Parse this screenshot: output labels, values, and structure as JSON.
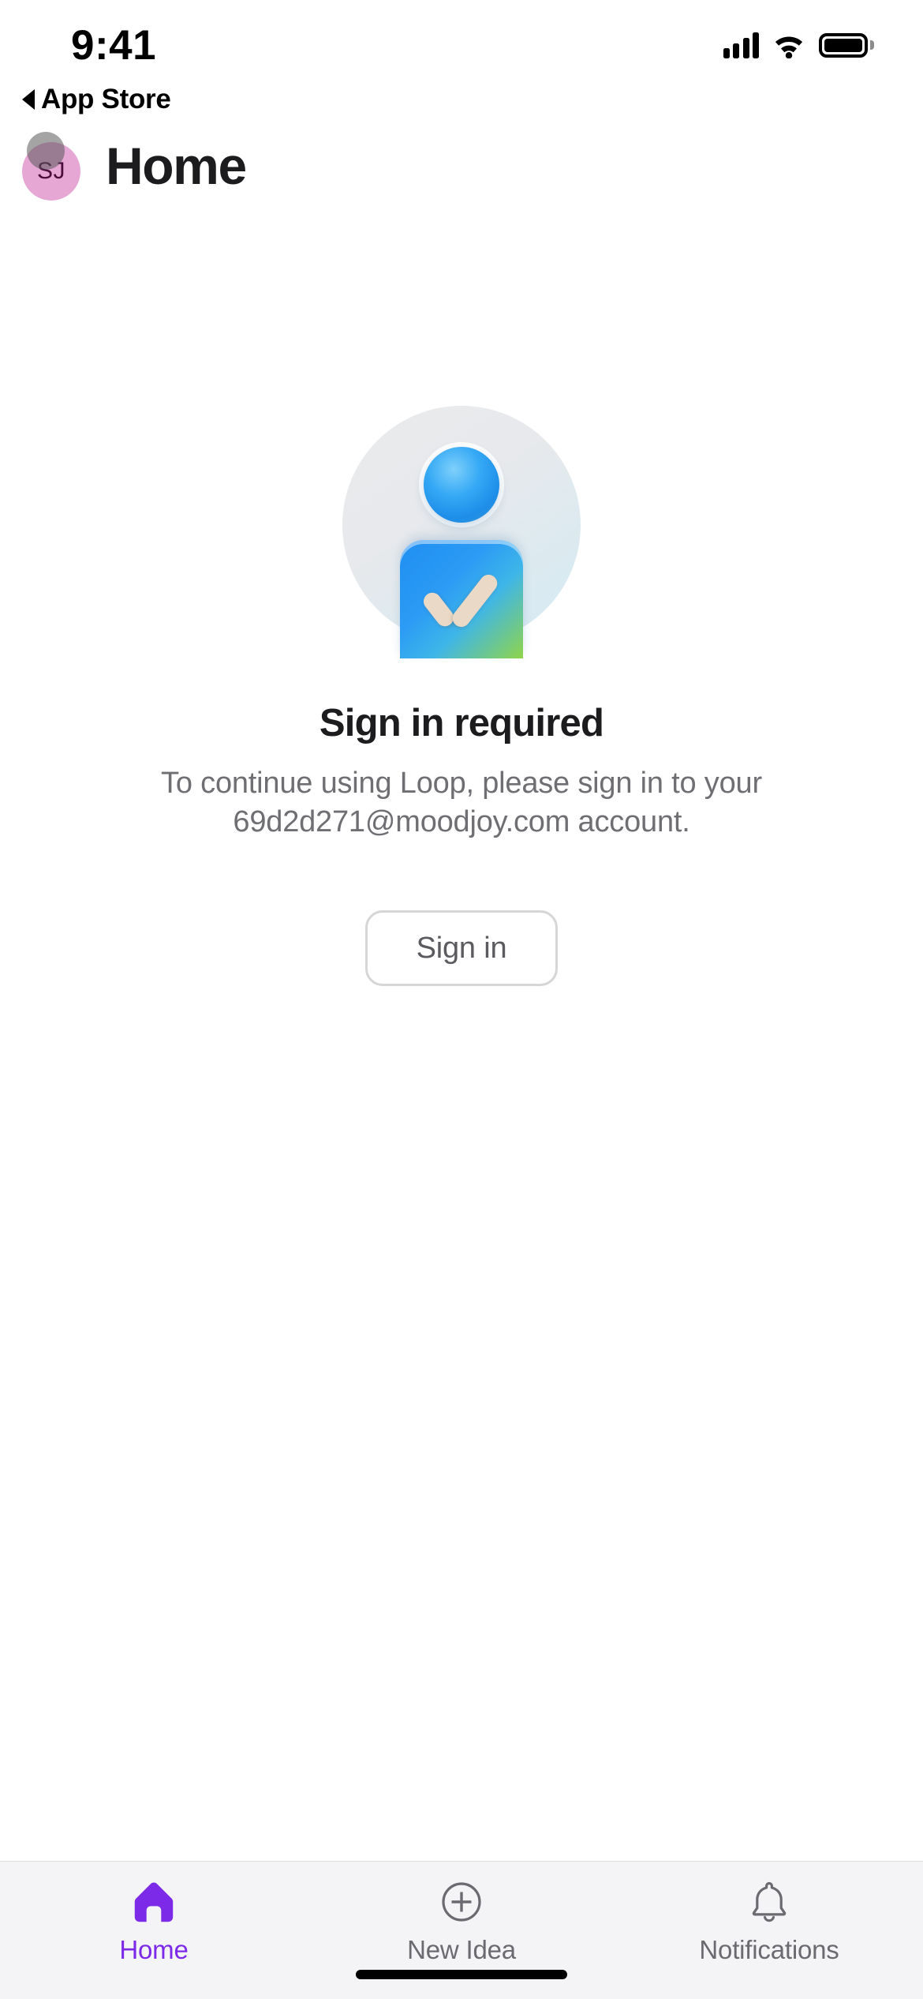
{
  "status_bar": {
    "time": "9:41",
    "signal_icon": "cellular-signal-icon",
    "wifi_icon": "wifi-icon",
    "battery_icon": "battery-icon"
  },
  "back_nav": {
    "label": "App Store",
    "caret_icon": "back-caret-icon"
  },
  "header": {
    "title": "Home",
    "avatar_initials": "SJ",
    "avatar_color": "#e7a7d4",
    "avatar_text_color": "#4a0d3c"
  },
  "main": {
    "illustration_name": "signed-out-person-check-illustration",
    "headline": "Sign in required",
    "body_line_1": "To continue using Loop, please sign in to your",
    "body_line_2": "69d2d271@moodjoy.com account.",
    "body_full": "To continue using Loop, please sign in to your 69d2d271@moodjoy.com account.",
    "app_name": "Loop",
    "account_email": "69d2d271@moodjoy.com",
    "sign_in_button": "Sign in"
  },
  "tab_bar": {
    "active_color": "#7c2ae8",
    "inactive_color": "#6a6a70",
    "items": [
      {
        "label": "Home",
        "icon": "home-icon",
        "active": true
      },
      {
        "label": "New Idea",
        "icon": "plus-circle-icon",
        "active": false
      },
      {
        "label": "Notifications",
        "icon": "bell-icon",
        "active": false
      }
    ]
  }
}
